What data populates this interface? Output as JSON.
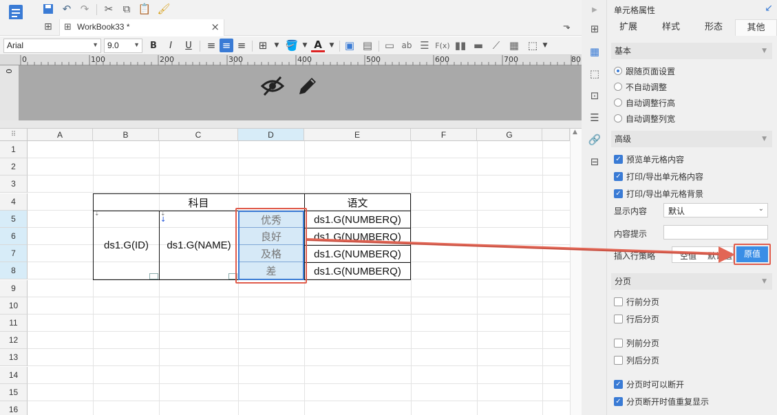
{
  "toolbar": {
    "font_name": "Arial",
    "font_size": "9.0",
    "bold": "B",
    "italic": "I",
    "underline": "U",
    "text_abc": "ab",
    "formula_fx": "F(x)"
  },
  "tabs": [
    {
      "label": "WorkBook33 *",
      "close": "×"
    }
  ],
  "ruler": {
    "marks": [
      "0",
      "100",
      "200",
      "300",
      "400",
      "500",
      "600",
      "700",
      "80"
    ]
  },
  "vruler_label": "0",
  "columns": [
    "A",
    "B",
    "C",
    "D",
    "E",
    "F",
    "G"
  ],
  "rows": [
    "1",
    "2",
    "3",
    "4",
    "5",
    "6",
    "7",
    "8",
    "9",
    "10",
    "11",
    "12",
    "13",
    "14",
    "15",
    "16"
  ],
  "sheet": {
    "header_subject": "科目",
    "header_chinese": "语文",
    "cell_id": "ds1.G(ID)",
    "cell_name": "ds1.G(NAME)",
    "grades": [
      "优秀",
      "良好",
      "及格",
      "差"
    ],
    "e_values": [
      "ds1.G(NUMBERQ)",
      "ds1.G(NUMBERQ)",
      "ds1.G(NUMBERQ)",
      "ds1.G(NUMBERQ)"
    ]
  },
  "panel": {
    "title": "单元格属性",
    "tabs": [
      "扩展",
      "样式",
      "形态",
      "其他"
    ],
    "active_tab": "其他",
    "basic": {
      "title": "基本",
      "options": [
        "跟随页面设置",
        "不自动调整",
        "自动调整行高",
        "自动调整列宽"
      ],
      "selected": "跟随页面设置"
    },
    "advanced": {
      "title": "高级",
      "checks": [
        "预览单元格内容",
        "打印/导出单元格内容",
        "打印/导出单元格背景"
      ],
      "display_label": "显示内容",
      "display_value": "默认",
      "hint_label": "内容提示",
      "hint_value": "",
      "insert_label": "插入行策略",
      "insert_options": [
        "空值",
        "默认值",
        "原值"
      ],
      "insert_selected": "原值"
    },
    "paging": {
      "title": "分页",
      "checks": [
        "行前分页",
        "行后分页",
        "列前分页",
        "列后分页",
        "分页时可以断开",
        "分页断开时值重复显示"
      ],
      "checked": [
        false,
        false,
        false,
        false,
        true,
        true
      ]
    }
  },
  "colors": {
    "accent": "#3a7bd5",
    "highlight_red": "#e05a4a",
    "selected_col": "#d7ecf8",
    "annotation_arrow": "#e26655"
  }
}
